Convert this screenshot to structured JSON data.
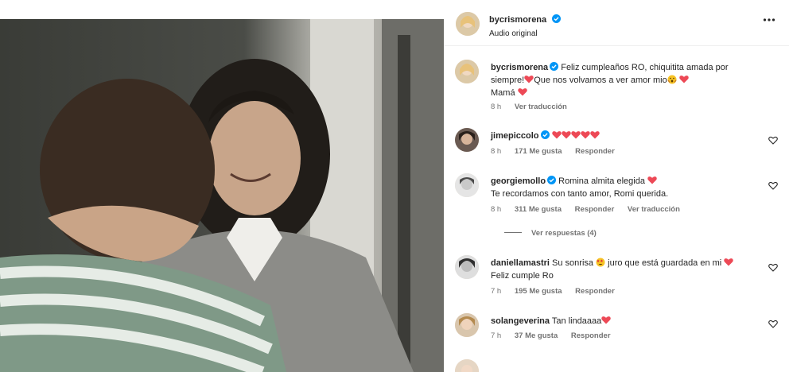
{
  "media": {
    "type": "video-frame"
  },
  "post": {
    "username": "bycrismorena",
    "audio": "Audio original",
    "caption": {
      "username": "bycrismorena",
      "line1": "Feliz cumpleaños RO, chiquitita amada por",
      "line2a": "siempre!",
      "line2b": "Que nos volvamos a ver amor mio",
      "line3": "Mamá",
      "time": "8 h",
      "translate": "Ver traducción"
    }
  },
  "comments": [
    {
      "username": "jimepiccolo",
      "verified": true,
      "text": "",
      "hearts": 5,
      "time": "8 h",
      "likes": "171 Me gusta",
      "reply": "Responder"
    },
    {
      "username": "georgiemollo",
      "verified": true,
      "text": "Romina almita elegida",
      "text2": "Te recordamos con tanto amor, Romi querida.",
      "time": "8 h",
      "likes": "311 Me gusta",
      "reply": "Responder",
      "translate": "Ver traducción",
      "view_replies": "Ver respuestas (4)"
    },
    {
      "username": "daniellamastri",
      "text": "Su sonrisa",
      "text_b": "juro que está guardada en mi",
      "text2": "Feliz cumple Ro",
      "time": "7 h",
      "likes": "195 Me gusta",
      "reply": "Responder"
    },
    {
      "username": "solangeverina",
      "text": "Tan lindaaaa",
      "time": "7 h",
      "likes": "37 Me gusta",
      "reply": "Responder"
    }
  ],
  "colors": {
    "verified": "#0095f6",
    "heart": "#ed4956",
    "meta": "#737373",
    "text": "#262626"
  },
  "icons": [
    "more-options-icon",
    "verified-badge-icon",
    "heart-outline-icon",
    "red-heart-emoji",
    "face-with-open-mouth-emoji",
    "star-struck-emoji"
  ]
}
